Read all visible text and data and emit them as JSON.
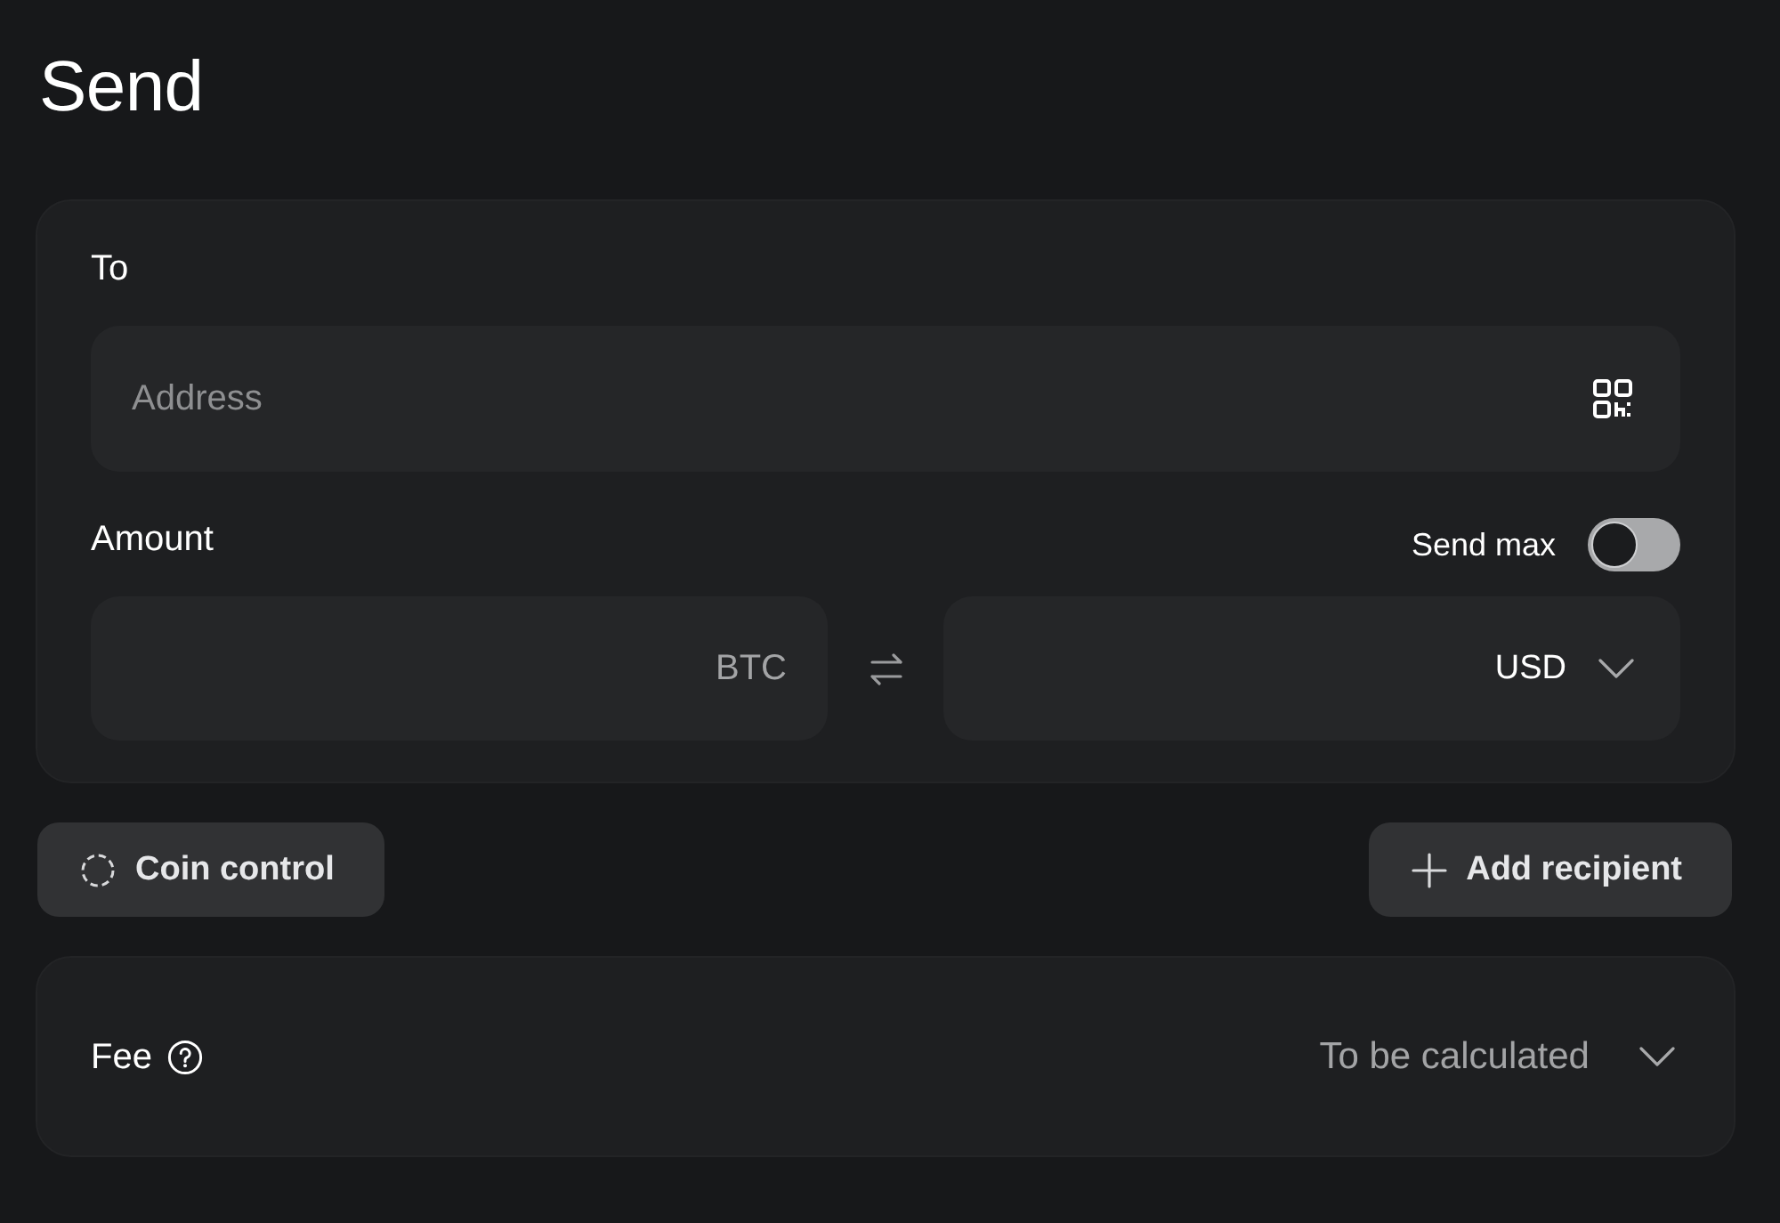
{
  "title": "Send",
  "recipient": {
    "label": "To",
    "address_field": {
      "placeholder": "Address"
    }
  },
  "amount": {
    "label": "Amount",
    "send_max": {
      "label": "Send max",
      "on": false
    },
    "crypto_field": {
      "unit": "BTC"
    },
    "fiat_field": {
      "currency": "USD"
    }
  },
  "actions": [
    {
      "label": "Coin control",
      "kind": "coin-control"
    },
    {
      "label": "Add recipient",
      "kind": "add"
    }
  ],
  "fee": {
    "label": "Fee",
    "value": "To be calculated"
  }
}
